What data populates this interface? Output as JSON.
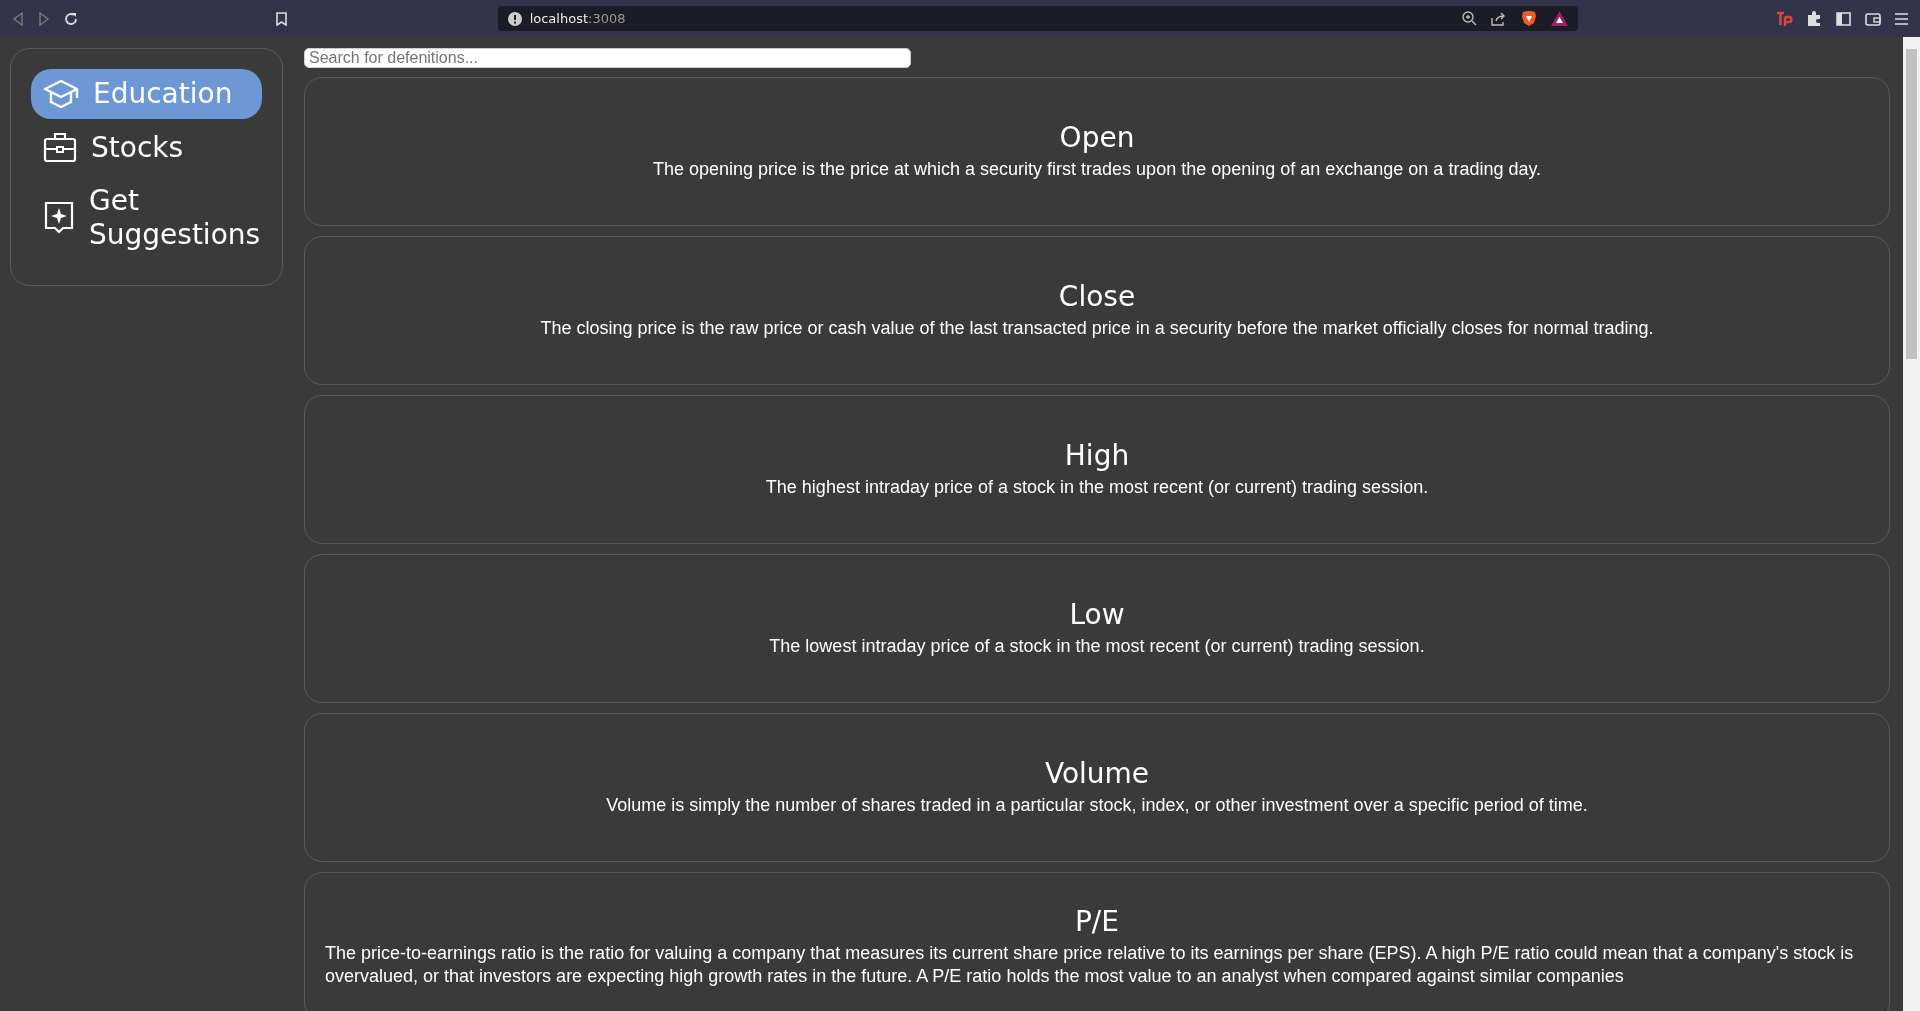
{
  "browser": {
    "url_host": "localhost",
    "url_port": ":3008"
  },
  "sidebar": {
    "items": [
      {
        "label": "Education",
        "kind": "education",
        "selected": true
      },
      {
        "label": "Stocks",
        "kind": "stocks",
        "selected": false
      },
      {
        "label": "Get Suggestions",
        "kind": "suggestions",
        "selected": false
      }
    ]
  },
  "search": {
    "placeholder": "Search for defenitions..."
  },
  "definitions": [
    {
      "title": "Open",
      "description": "The opening price is the price at which a security first trades upon the opening of an exchange on a trading day."
    },
    {
      "title": "Close",
      "description": "The closing price is the raw price or cash value of the last transacted price in a security before the market officially closes for normal trading."
    },
    {
      "title": "High",
      "description": "The highest intraday price of a stock in the most recent (or current) trading session."
    },
    {
      "title": "Low",
      "description": "The lowest intraday price of a stock in the most recent (or current) trading session."
    },
    {
      "title": "Volume",
      "description": "Volume is simply the number of shares traded in a particular stock, index, or other investment over a specific period of time."
    },
    {
      "title": "P/E",
      "description": "The price-to-earnings ratio is the ratio for valuing a company that measures its current share price relative to its earnings per share (EPS). A high P/E ratio could mean that a company's stock is overvalued, or that investors are expecting high growth rates in the future. A P/E ratio holds the most value to an analyst when compared against similar companies"
    }
  ]
}
